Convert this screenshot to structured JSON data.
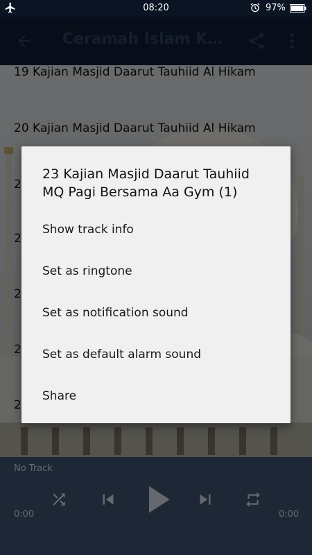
{
  "status_bar": {
    "time": "08:20",
    "battery_percent": "97%",
    "icons": [
      "airplane-icon",
      "alarm-icon",
      "battery-icon"
    ]
  },
  "toolbar": {
    "title": "Ceramah Islam KH Abdullah Gymnastiar",
    "icons": [
      "back-arrow-icon",
      "share-icon",
      "more-vert-icon"
    ]
  },
  "tracks": [
    "19 Kajian Masjid Daarut Tauhiid Al Hikam",
    "20 Kajian Masjid Daarut Tauhiid Al Hikam",
    "2",
    "2",
    "2",
    "2",
    "2"
  ],
  "dialog": {
    "title": "23 Kajian Masjid Daarut Tauhiid MQ Pagi Bersama Aa Gym (1)",
    "options": [
      "Show track info",
      "Set as ringtone",
      "Set as notification sound",
      "Set as default alarm sound",
      "Share"
    ]
  },
  "player": {
    "now_playing": "No Track",
    "elapsed": "0:00",
    "duration": "0:00",
    "icons": [
      "shuffle-icon",
      "skip-previous-icon",
      "play-icon",
      "skip-next-icon",
      "repeat-icon"
    ]
  },
  "colors": {
    "toolbar": "#0e1d33",
    "status_bar": "#0a1422",
    "player": "#3d4f6a",
    "dialog": "#f0f0f0"
  }
}
